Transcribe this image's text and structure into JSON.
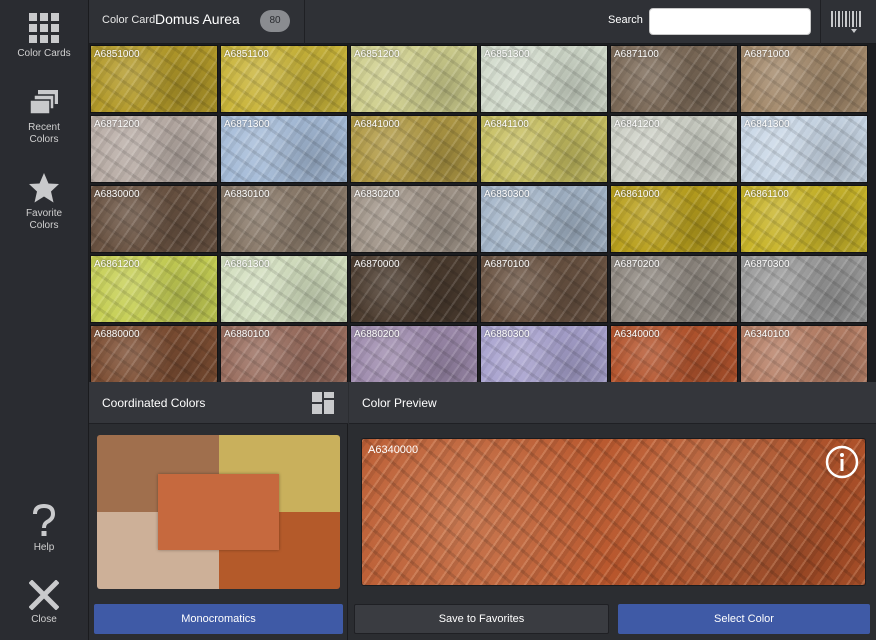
{
  "sidebar": {
    "items": [
      {
        "label": "Color Cards",
        "icon": "grid-icon"
      },
      {
        "label": "Recent Colors",
        "icon": "stack-icon"
      },
      {
        "label": "Favorite Colors",
        "icon": "star-icon"
      },
      {
        "label": "Help",
        "icon": "question-icon"
      },
      {
        "label": "Close",
        "icon": "close-icon"
      }
    ]
  },
  "header": {
    "card_label": "Color Card",
    "card_name": "Domus Aurea",
    "count": "80",
    "search_label": "Search",
    "search_value": "",
    "barcode_icon": "barcode-icon"
  },
  "swatches": [
    {
      "code": "A6851000",
      "color": "#b39a2a"
    },
    {
      "code": "A6851100",
      "color": "#c9b43a"
    },
    {
      "code": "A6851200",
      "color": "#cfcf8e"
    },
    {
      "code": "A6851300",
      "color": "#d2dbcc"
    },
    {
      "code": "A6871100",
      "color": "#7c6a58"
    },
    {
      "code": "A6871000",
      "color": "#a48a6c"
    },
    {
      "code": "A6871200",
      "color": "#b9ada6"
    },
    {
      "code": "A6871300",
      "color": "#a6bcd8"
    },
    {
      "code": "A6841000",
      "color": "#b19a45"
    },
    {
      "code": "A6841100",
      "color": "#c7bf62"
    },
    {
      "code": "A6841200",
      "color": "#cdd0c6"
    },
    {
      "code": "A6841300",
      "color": "#c9d7e6"
    },
    {
      "code": "A6830000",
      "color": "#6a5342"
    },
    {
      "code": "A6830100",
      "color": "#8a7a6a"
    },
    {
      "code": "A6830200",
      "color": "#a2968a"
    },
    {
      "code": "A6830300",
      "color": "#a5b6c9"
    },
    {
      "code": "A6861000",
      "color": "#b9a01e"
    },
    {
      "code": "A6861100",
      "color": "#c8b42a"
    },
    {
      "code": "A6861200",
      "color": "#c6cf55"
    },
    {
      "code": "A6861300",
      "color": "#d3dfbf"
    },
    {
      "code": "A6870000",
      "color": "#4d3d30"
    },
    {
      "code": "A6870100",
      "color": "#6b5443"
    },
    {
      "code": "A6870200",
      "color": "#8f8880"
    },
    {
      "code": "A6870300",
      "color": "#9b9b9b"
    },
    {
      "code": "A6880000",
      "color": "#7d4e33"
    },
    {
      "code": "A6880100",
      "color": "#9a6e5f"
    },
    {
      "code": "A6880200",
      "color": "#9f8cae"
    },
    {
      "code": "A6880300",
      "color": "#a9a3cf"
    },
    {
      "code": "A6340000",
      "color": "#b4552e"
    },
    {
      "code": "A6340100",
      "color": "#b78067"
    }
  ],
  "coordinated": {
    "title": "Coordinated Colors",
    "layout_icon": "layout-icon",
    "blocks": {
      "top_left": "#a06f4d",
      "top_right": "#c9b05c",
      "bottom_left": "#cdb098",
      "bottom_right": "#b45a2a",
      "center": "#c6693e"
    },
    "button": "Monocromatics"
  },
  "preview": {
    "title": "Color Preview",
    "code": "A6340000",
    "color": "#b8562c",
    "info_icon": "info-icon",
    "save_button": "Save to Favorites",
    "select_button": "Select Color"
  }
}
